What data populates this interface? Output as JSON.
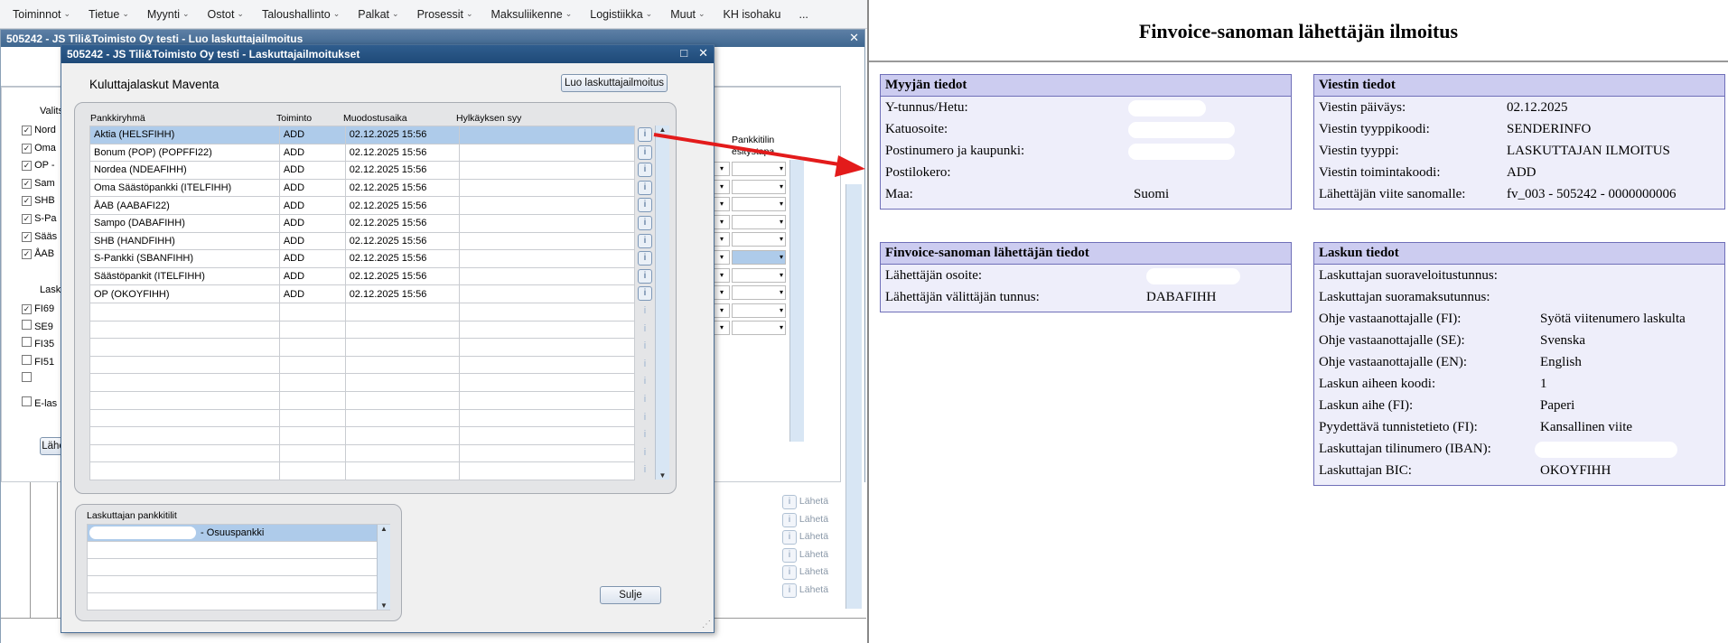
{
  "menubar": [
    "Toiminnot",
    "Tietue",
    "Myynti",
    "Ostot",
    "Taloushallinto",
    "Palkat",
    "Prosessit",
    "Maksuliikenne",
    "Logistiikka",
    "Muut",
    "KH isohaku",
    "..."
  ],
  "back_window": {
    "title": "505242 - JS Tili&Toimisto Oy testi - Luo laskuttajailmoitus",
    "partial_labels": [
      "Valits",
      "Nord",
      "Oma",
      "OP -",
      "Sam",
      "SHB",
      "S-Pa",
      "Sääs",
      "ÅAB"
    ],
    "lask_label": "Lask",
    "accounts": [
      "FI69",
      "SE9",
      "FI35",
      "FI51",
      ""
    ],
    "elaskut": "E-las",
    "send_btn": "Lähe",
    "pankkitilin_header": "Pankkitilin esitystapa",
    "laheta_labels": [
      "Lähetä",
      "Lähetä",
      "Lähetä",
      "Lähetä",
      "Lähetä",
      "Lähetä"
    ]
  },
  "dialog": {
    "title": "505242 - JS Tili&Toimisto Oy testi - Laskuttajailmoitukset",
    "heading": "Kuluttajalaskut Maventa",
    "create_btn": "Luo laskuttajailmoitus",
    "columns": [
      "Pankkiryhmä",
      "Toiminto",
      "Muodostusaika",
      "Hylkäyksen syy"
    ],
    "rows": [
      {
        "bank": "Aktia (HELSFIHH)",
        "action": "ADD",
        "time": "02.12.2025 15:56",
        "reason": ""
      },
      {
        "bank": "Bonum (POP) (POPFFI22)",
        "action": "ADD",
        "time": "02.12.2025 15:56",
        "reason": ""
      },
      {
        "bank": "Nordea (NDEAFIHH)",
        "action": "ADD",
        "time": "02.12.2025 15:56",
        "reason": ""
      },
      {
        "bank": "Oma Säästöpankki (ITELFIHH)",
        "action": "ADD",
        "time": "02.12.2025 15:56",
        "reason": ""
      },
      {
        "bank": "ÅAB (AABAFI22)",
        "action": "ADD",
        "time": "02.12.2025 15:56",
        "reason": ""
      },
      {
        "bank": "Sampo (DABAFIHH)",
        "action": "ADD",
        "time": "02.12.2025 15:56",
        "reason": ""
      },
      {
        "bank": "SHB (HANDFIHH)",
        "action": "ADD",
        "time": "02.12.2025 15:56",
        "reason": ""
      },
      {
        "bank": "S-Pankki (SBANFIHH)",
        "action": "ADD",
        "time": "02.12.2025 15:56",
        "reason": ""
      },
      {
        "bank": "Säästöpankit (ITELFIHH)",
        "action": "ADD",
        "time": "02.12.2025 15:56",
        "reason": ""
      },
      {
        "bank": "OP (OKOYFIHH)",
        "action": "ADD",
        "time": "02.12.2025 15:56",
        "reason": ""
      }
    ],
    "info_label": "i",
    "accounts_title": "Laskuttajan pankkitilit",
    "accounts": [
      " - Osuuspankki"
    ],
    "close_btn": "Sulje"
  },
  "document": {
    "title": "Finvoice-sanoman lähettäjän ilmoitus",
    "seller": {
      "header": "Myyjän tiedot",
      "rows": [
        {
          "label": "Y-tunnus/Hetu:",
          "value": ""
        },
        {
          "label": "Katuosoite:",
          "value": ""
        },
        {
          "label": "Postinumero ja kaupunki:",
          "value": ""
        },
        {
          "label": "Postilokero:",
          "value": ""
        },
        {
          "label": "Maa:",
          "value": "Suomi"
        }
      ]
    },
    "message": {
      "header": "Viestin tiedot",
      "rows": [
        {
          "label": "Viestin päiväys:",
          "value": "02.12.2025"
        },
        {
          "label": "Viestin tyyppikoodi:",
          "value": "SENDERINFO"
        },
        {
          "label": "Viestin tyyppi:",
          "value": "LASKUTTAJAN ILMOITUS"
        },
        {
          "label": "Viestin toimintakoodi:",
          "value": "ADD"
        },
        {
          "label": "Lähettäjän viite sanomalle:",
          "value": "fv_003 - 505242 - 0000000006"
        }
      ]
    },
    "sender": {
      "header": "Finvoice-sanoman lähettäjän tiedot",
      "rows": [
        {
          "label": "Lähettäjän osoite:",
          "value": ""
        },
        {
          "label": "Lähettäjän välittäjän tunnus:",
          "value": "DABAFIHH"
        }
      ]
    },
    "invoice": {
      "header": "Laskun tiedot",
      "rows": [
        {
          "label": "Laskuttajan suoraveloitustunnus:",
          "value": ""
        },
        {
          "label": "Laskuttajan suoramaksutunnus:",
          "value": ""
        },
        {
          "label": "Ohje vastaanottajalle (FI):",
          "value": "Syötä viitenumero laskulta"
        },
        {
          "label": "Ohje vastaanottajalle (SE):",
          "value": "Svenska"
        },
        {
          "label": "Ohje vastaanottajalle (EN):",
          "value": "English"
        },
        {
          "label": "Laskun aiheen koodi:",
          "value": "1"
        },
        {
          "label": "Laskun aihe (FI):",
          "value": "Paperi"
        },
        {
          "label": "Pyydettävä tunnistetieto (FI):",
          "value": "Kansallinen viite"
        },
        {
          "label": "Laskuttajan tilinumero (IBAN):",
          "value": ""
        },
        {
          "label": "Laskuttajan BIC:",
          "value": "OKOYFIHH"
        }
      ]
    }
  }
}
